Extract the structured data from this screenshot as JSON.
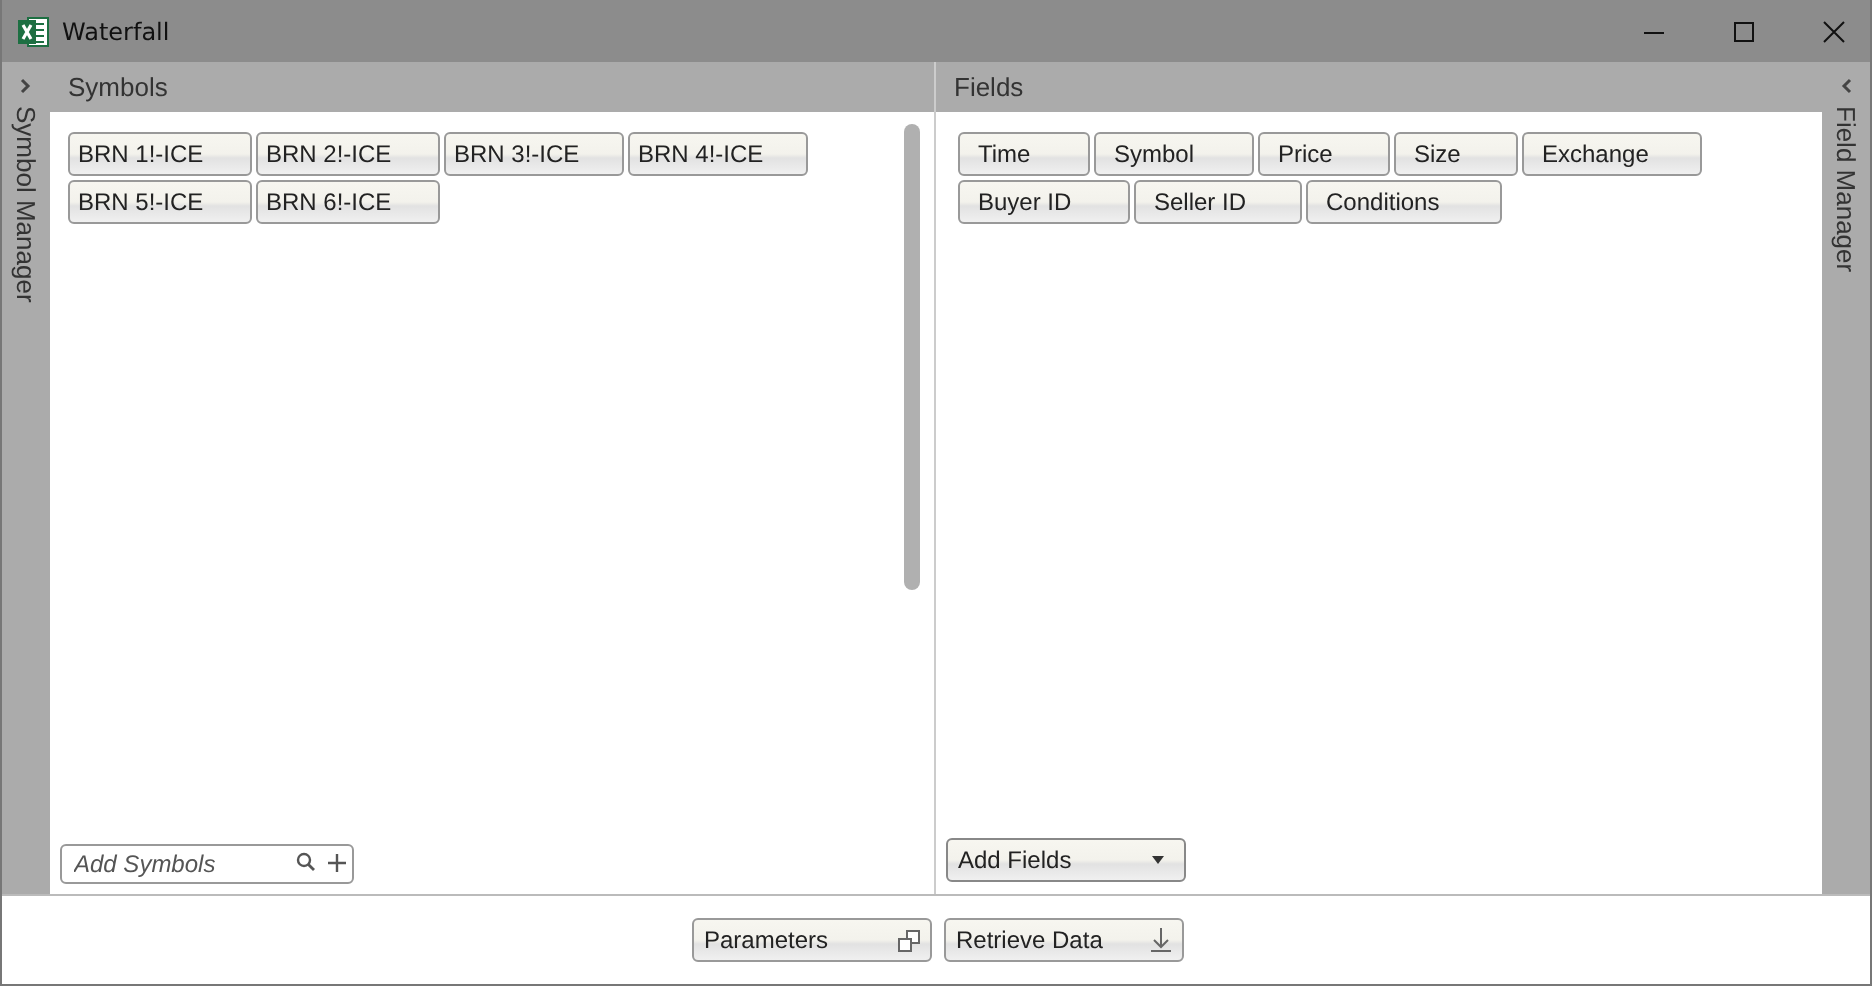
{
  "window": {
    "title": "Waterfall"
  },
  "left_sidebar": {
    "label": "Symbol Manager"
  },
  "right_sidebar": {
    "label": "Field Manager"
  },
  "symbols_panel": {
    "title": "Symbols",
    "chips": [
      "BRN 1!-ICE",
      "BRN 2!-ICE",
      "BRN 3!-ICE",
      "BRN 4!-ICE",
      "BRN 5!-ICE",
      "BRN 6!-ICE"
    ],
    "search": {
      "placeholder": "Add Symbols"
    }
  },
  "fields_panel": {
    "title": "Fields",
    "chips": [
      "Time",
      "Symbol",
      "Price",
      "Size",
      "Exchange",
      "Buyer ID",
      "Seller ID",
      "Conditions"
    ],
    "dropdown": {
      "label": "Add Fields"
    }
  },
  "footer_buttons": [
    {
      "label": "Parameters",
      "kind": "popout"
    },
    {
      "label": "Retrieve Data",
      "kind": "download"
    }
  ]
}
